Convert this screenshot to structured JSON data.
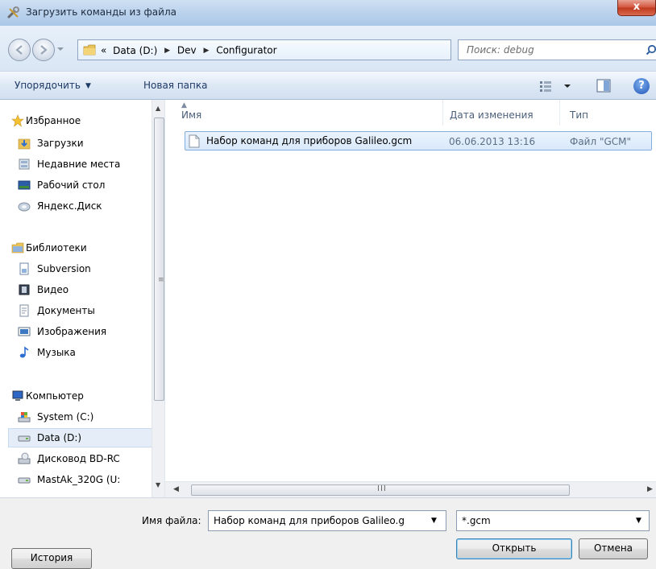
{
  "window": {
    "title": "Загрузить команды из файла",
    "close_label": "x"
  },
  "address": {
    "overflow": "«",
    "crumbs": [
      "Data (D:)",
      "Dev",
      "Configurator"
    ],
    "search_placeholder": "Поиск: debug"
  },
  "toolbar": {
    "organize_label": "Упорядочить",
    "new_folder_label": "Новая папка",
    "help_label": "?"
  },
  "nav": {
    "favorites": "Избранное",
    "downloads": "Загрузки",
    "recent": "Недавние места",
    "desktop": "Рабочий стол",
    "yandex": "Яндекс.Диск",
    "libraries": "Библиотеки",
    "subversion": "Subversion",
    "video": "Видео",
    "documents": "Документы",
    "images": "Изображения",
    "music": "Музыка",
    "computer": "Компьютер",
    "system_c": "System (C:)",
    "data_d": "Data (D:)",
    "bd_drive": "Дисковод BD-RC",
    "mastak": "MastAk_320G (U:"
  },
  "columns": {
    "name": "Имя",
    "date": "Дата изменения",
    "type": "Тип"
  },
  "files": [
    {
      "name": "Набор команд для приборов Galileo.gcm",
      "date": "06.06.2013 13:16",
      "type": "Файл \"GCM\""
    }
  ],
  "hscroll": {
    "grip": "III"
  },
  "footer": {
    "filename_label": "Имя файла:",
    "filename_value": "Набор команд для приборов Galileo.g",
    "filter_value": "*.gcm",
    "open_label": "Открыть",
    "cancel_label": "Отмена",
    "history_label": "История"
  },
  "colors": {
    "titlebar": "#b9d1ec",
    "close_button": "#c0391f",
    "selection": "#d9e9fb",
    "selection_border": "#84acdd"
  }
}
